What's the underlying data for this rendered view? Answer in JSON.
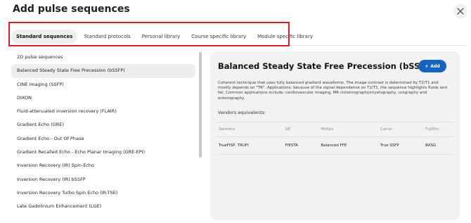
{
  "dialog": {
    "title": "Add pulse sequences"
  },
  "tabs": [
    {
      "label": "Standard sequences",
      "active": true
    },
    {
      "label": "Standard protocols"
    },
    {
      "label": "Personal library"
    },
    {
      "label": "Course specific library"
    },
    {
      "label": "Module specific library"
    }
  ],
  "sequences": [
    "2D pulse sequences",
    "Balanced Steady State Free Precession (bSSFP)",
    "CINE imaging (SSFP)",
    "DIXON",
    "Fluid-attenuated inversion recovery (FLAIR)",
    "Gradient Echo (GRE)",
    "Gradient Echo - Out Of Phase",
    "Gradient Recalled Echo - Echo Planar Imaging (GRE-EPI)",
    "Inversion Recovery (IR) Spin-Echo",
    "Inversion Recovery (IR) bSSFP",
    "Inversion Recovery Turbo Spin Echo (IR-TSE)",
    "Late Gadolinium Enhancement (LGE)"
  ],
  "selected_index": 1,
  "detail": {
    "title": "Balanced Steady State Free Precession (bSSFP)",
    "add_label": "Add",
    "description": "Coherent technique that uses fully balanced gradient waveforms. The image contrast is determined by T2/T1 and mostly depends on \"TR\". Applications: because of the signal dependence on T2/T1, the sequence highlights fluids and fat. Common applications include: cardiovascular imaging, MR cisternography/myelography, urography and enterography.",
    "vendors_label": "Vendors equivalents:",
    "vendor_headers": [
      "Siemens",
      "GE",
      "Philips",
      "Canon",
      "Fujifilm"
    ],
    "vendor_values": [
      "TrueFISP, TRUFI",
      "FIESTA",
      "Balanced FFE",
      "True SSFP",
      "BASG"
    ]
  },
  "colors": {
    "accent": "#1565c0",
    "highlight": "#e11d24",
    "panel_bg": "#f2f2f4"
  }
}
